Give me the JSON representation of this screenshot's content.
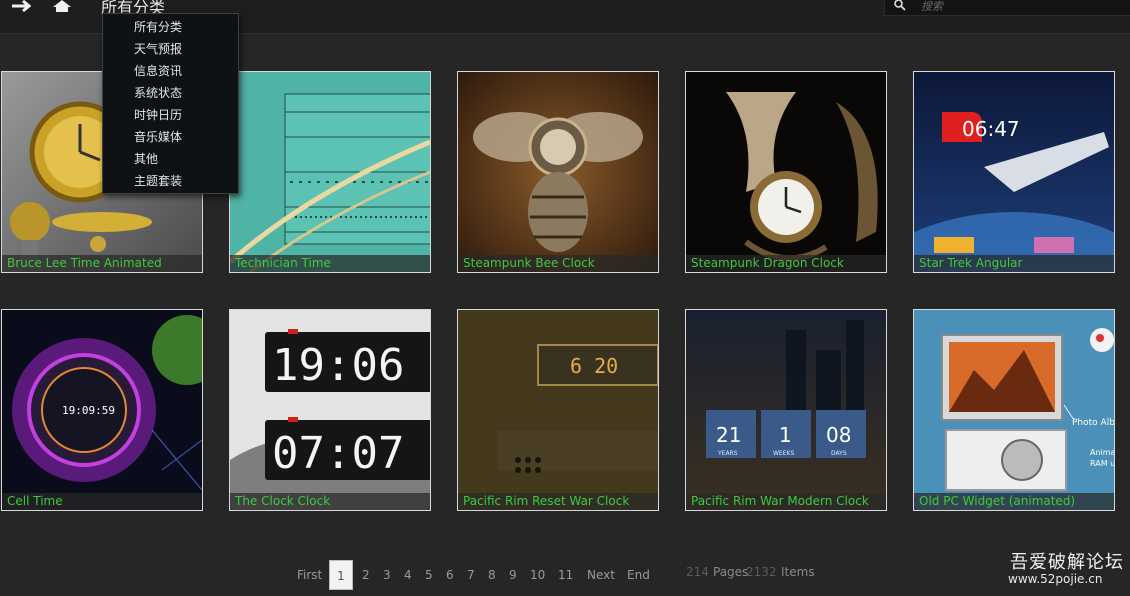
{
  "header": {
    "title": "所有分类",
    "search_placeholder": "搜索"
  },
  "dropdown": {
    "items": [
      "所有分类",
      "天气预报",
      "信息资讯",
      "系统状态",
      "时钟日历",
      "音乐媒体",
      "其他",
      "主题套装"
    ]
  },
  "tiles": [
    {
      "title": "Bruce Lee Time Animated",
      "art": "bruce-lee-clock-thumbnail"
    },
    {
      "title": "Technician Time",
      "art": "technician-calendar-thumbnail"
    },
    {
      "title": "Steampunk Bee Clock",
      "art": "steampunk-bee-thumbnail"
    },
    {
      "title": "Steampunk Dragon Clock",
      "art": "steampunk-dragon-thumbnail"
    },
    {
      "title": "Star Trek Angular",
      "art": "star-trek-thumbnail",
      "clock_text": "06:47"
    },
    {
      "title": "Cell Time",
      "art": "cell-time-thumbnail",
      "clock_text": "19:09:59"
    },
    {
      "title": "The Clock Clock",
      "art": "clock-clock-thumbnail",
      "clock_text": [
        "19:06",
        "07:07"
      ]
    },
    {
      "title": "Pacific Rim Reset War Clock",
      "art": "pacific-rim-reset-thumbnail",
      "clock_text": "6 20"
    },
    {
      "title": "Pacific Rim War Modern Clock",
      "art": "pacific-rim-modern-thumbnail",
      "clock_values": [
        "21",
        "1",
        "08"
      ],
      "clock_labels": [
        "YEARS",
        "WEEKS",
        "DAYS"
      ]
    },
    {
      "title": "Old PC Widget (animated)",
      "art": "old-pc-widget-thumbnail",
      "notes": [
        "Photo Album",
        "Anima",
        "RAM u"
      ]
    }
  ],
  "pagination": {
    "first": "First",
    "pages": [
      "1",
      "2",
      "3",
      "4",
      "5",
      "6",
      "7",
      "8",
      "9",
      "10",
      "11"
    ],
    "current": "1",
    "next": "Next",
    "end": "End",
    "total_pages": "214",
    "pages_label": "Pages",
    "total_items": "2132",
    "items_label": "Items"
  },
  "watermark": {
    "name": "吾爱破解论坛",
    "url": "www.52pojie.cn"
  },
  "colors": {
    "caption_text": "#3ec93e",
    "background": "#262626",
    "topbar": "#1e1e1e"
  }
}
